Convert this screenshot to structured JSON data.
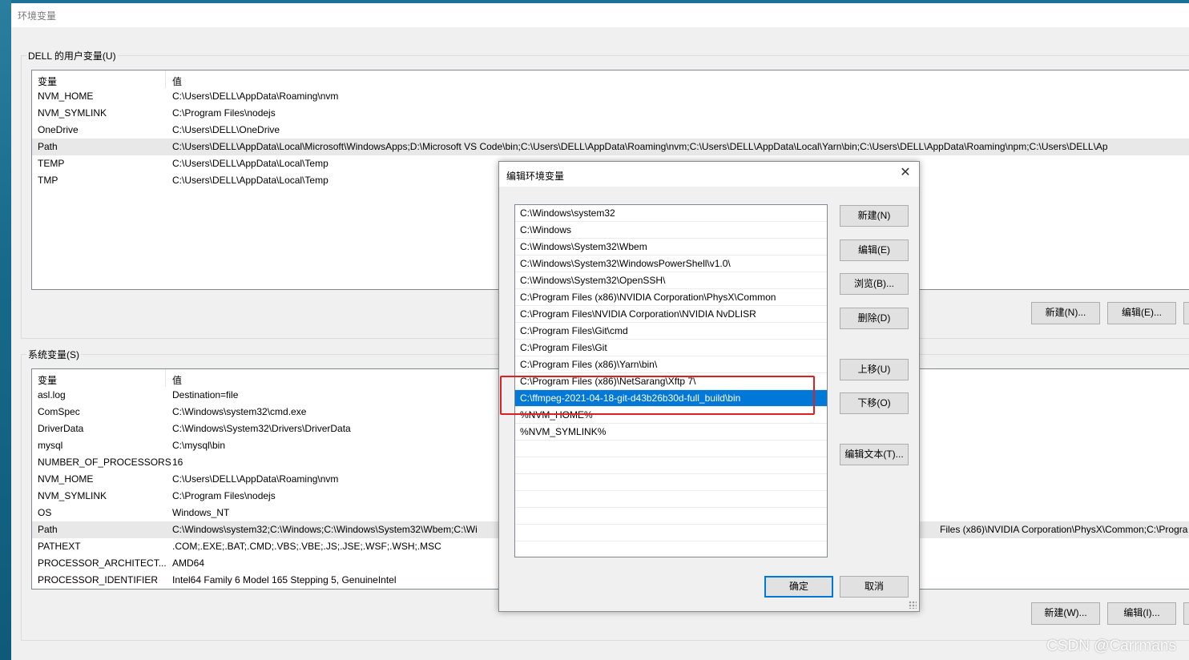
{
  "window": {
    "title": "环境变量"
  },
  "user_vars": {
    "label": "DELL 的用户变量(U)",
    "col_var": "变量",
    "col_val": "值",
    "rows": [
      {
        "name": "NVM_HOME",
        "value": "C:\\Users\\DELL\\AppData\\Roaming\\nvm"
      },
      {
        "name": "NVM_SYMLINK",
        "value": "C:\\Program Files\\nodejs"
      },
      {
        "name": "OneDrive",
        "value": "C:\\Users\\DELL\\OneDrive"
      },
      {
        "name": "Path",
        "value": "C:\\Users\\DELL\\AppData\\Local\\Microsoft\\WindowsApps;D:\\Microsoft VS Code\\bin;C:\\Users\\DELL\\AppData\\Roaming\\nvm;C:\\Users\\DELL\\AppData\\Local\\Yarn\\bin;C:\\Users\\DELL\\AppData\\Roaming\\npm;C:\\Users\\DELL\\Ap"
      },
      {
        "name": "TEMP",
        "value": "C:\\Users\\DELL\\AppData\\Local\\Temp"
      },
      {
        "name": "TMP",
        "value": "C:\\Users\\DELL\\AppData\\Local\\Temp"
      }
    ],
    "new_btn": "新建(N)...",
    "edit_btn": "编辑(E)..."
  },
  "sys_vars": {
    "label": "系统变量(S)",
    "col_var": "变量",
    "col_val": "值",
    "rows": [
      {
        "name": "asl.log",
        "value": "Destination=file"
      },
      {
        "name": "ComSpec",
        "value": "C:\\Windows\\system32\\cmd.exe"
      },
      {
        "name": "DriverData",
        "value": "C:\\Windows\\System32\\Drivers\\DriverData"
      },
      {
        "name": "mysql",
        "value": "C:\\mysql\\bin"
      },
      {
        "name": "NUMBER_OF_PROCESSORS",
        "value": "16"
      },
      {
        "name": "NVM_HOME",
        "value": "C:\\Users\\DELL\\AppData\\Roaming\\nvm"
      },
      {
        "name": "NVM_SYMLINK",
        "value": "C:\\Program Files\\nodejs"
      },
      {
        "name": "OS",
        "value": "Windows_NT"
      },
      {
        "name": "Path",
        "value": "C:\\Windows\\system32;C:\\Windows;C:\\Windows\\System32\\Wbem;C:\\Wi",
        "value_tail": "Files (x86)\\NVIDIA Corporation\\PhysX\\Common;C:\\Progra"
      },
      {
        "name": "PATHEXT",
        "value": ".COM;.EXE;.BAT;.CMD;.VBS;.VBE;.JS;.JSE;.WSF;.WSH;.MSC"
      },
      {
        "name": "PROCESSOR_ARCHITECT...",
        "value": "AMD64"
      },
      {
        "name": "PROCESSOR_IDENTIFIER",
        "value": "Intel64 Family 6 Model 165 Stepping 5, GenuineIntel"
      }
    ],
    "new_btn": "新建(W)...",
    "edit_btn": "编辑(I)..."
  },
  "dialog": {
    "title": "编辑环境变量",
    "close": "✕",
    "entries": [
      "C:\\Windows\\system32",
      "C:\\Windows",
      "C:\\Windows\\System32\\Wbem",
      "C:\\Windows\\System32\\WindowsPowerShell\\v1.0\\",
      "C:\\Windows\\System32\\OpenSSH\\",
      "C:\\Program Files (x86)\\NVIDIA Corporation\\PhysX\\Common",
      "C:\\Program Files\\NVIDIA Corporation\\NVIDIA NvDLISR",
      "C:\\Program Files\\Git\\cmd",
      "C:\\Program Files\\Git",
      "C:\\Program Files (x86)\\Yarn\\bin\\",
      "C:\\Program Files (x86)\\NetSarang\\Xftp 7\\",
      "C:\\ffmpeg-2021-04-18-git-d43b26b30d-full_build\\bin",
      "%NVM_HOME%",
      "%NVM_SYMLINK%",
      "",
      "",
      "",
      "",
      "",
      "",
      ""
    ],
    "selected_index": 11,
    "buttons": {
      "new": "新建(N)",
      "edit": "编辑(E)",
      "browse": "浏览(B)...",
      "delete": "删除(D)",
      "up": "上移(U)",
      "down": "下移(O)",
      "edit_text": "编辑文本(T)...",
      "ok": "确定",
      "cancel": "取消"
    }
  },
  "watermark": "CSDN @Carrmans",
  "colors": {
    "selection": "#0078d7",
    "annotation_box": "#e02020"
  }
}
